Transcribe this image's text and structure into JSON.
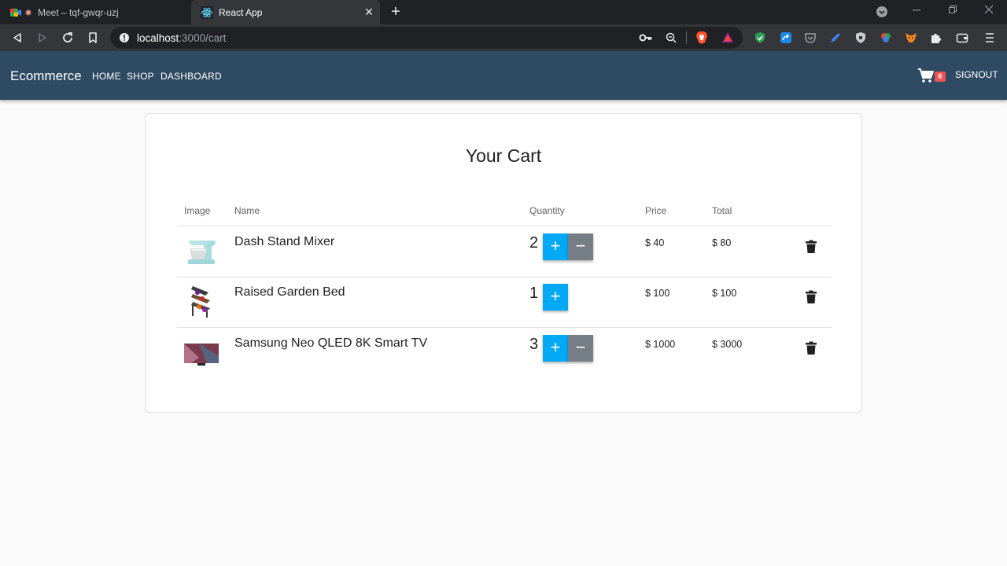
{
  "browser": {
    "tabs": [
      {
        "title": "Meet – tqf-gwqr-uzj",
        "active": false
      },
      {
        "title": "React App",
        "active": true
      }
    ],
    "url_host": "localhost",
    "url_path": ":3000/cart",
    "close_glyph": "✕",
    "newtab_glyph": "+"
  },
  "nav": {
    "brand": "Ecommerce",
    "links": [
      "HOME",
      "SHOP",
      "DASHBOARD"
    ],
    "cart_count": "6",
    "signout": "SIGNOUT"
  },
  "cart": {
    "title": "Your Cart",
    "columns": {
      "image": "Image",
      "name": "Name",
      "quantity": "Quantity",
      "price": "Price",
      "total": "Total"
    },
    "plus_label": "+",
    "minus_label": "−",
    "items": [
      {
        "name": "Dash Stand Mixer",
        "quantity": "2",
        "price": "$ 40",
        "total": "$ 80",
        "image": "stand-mixer-image"
      },
      {
        "name": "Raised Garden Bed",
        "quantity": "1",
        "price": "$ 100",
        "total": "$ 100",
        "image": "garden-bed-image"
      },
      {
        "name": "Samsung Neo QLED 8K Smart TV",
        "quantity": "3",
        "price": "$ 1000",
        "total": "$ 3000",
        "image": "smart-tv-image"
      }
    ]
  },
  "colors": {
    "appbar": "#2f4a63",
    "plus_button": "#03a9f4",
    "minus_button": "#757e85",
    "badge": "#ef5350"
  }
}
